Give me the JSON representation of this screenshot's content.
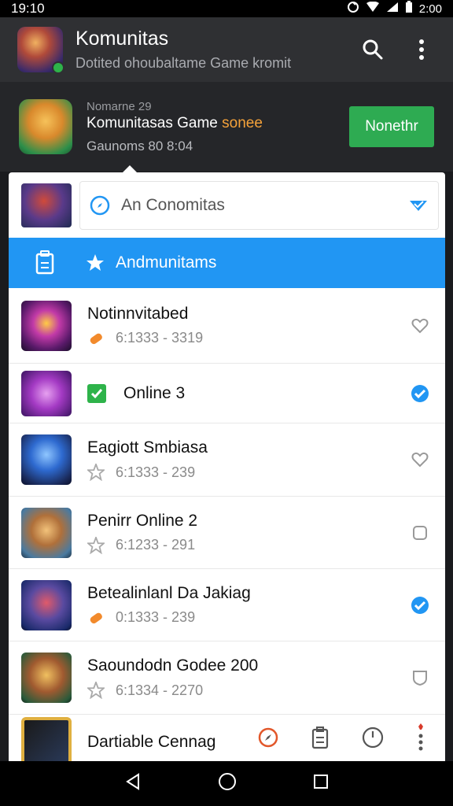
{
  "status_bar": {
    "time": "19:10",
    "clock_right": "2:00"
  },
  "app_bar": {
    "title": "Komunitas",
    "subtitle": "Dotited ohoubaltame Game kromit",
    "icons": [
      "search-icon",
      "more-vert-icon"
    ]
  },
  "banner": {
    "small_text": "Nomarne 29",
    "title": "Komunitasas Game",
    "title_accent": "sonee",
    "meta": "Gaunoms 80 8:04",
    "button_label": "Nonethr"
  },
  "search": {
    "value": "An Conomitas",
    "icon": "compass-icon"
  },
  "selected_item": {
    "label": "Andmunitams",
    "icon": "star-icon"
  },
  "list": [
    {
      "title": "Notinnvitabed",
      "meta": "6:1333 - 3319",
      "meta_icon": "gamepad-icon",
      "status": "heart",
      "checked": false
    },
    {
      "title": "Online 3",
      "meta": "",
      "meta_icon": "online-check-icon",
      "status": "check",
      "checked": true
    },
    {
      "title": "Eagiott Smbiasa",
      "meta": "6:1333 - 239",
      "meta_icon": "star-outline-icon",
      "status": "heart",
      "checked": false
    },
    {
      "title": "Penirr Online 2",
      "meta": "6:1233 - 291",
      "meta_icon": "star-outline-icon",
      "status": "box",
      "checked": false
    },
    {
      "title": "Betealinlanl Da Jakiag",
      "meta": "0:1333 - 239",
      "meta_icon": "gamepad-icon",
      "status": "check",
      "checked": true
    },
    {
      "title": "Saoundodn Godee 200",
      "meta": "6:1334 - 2270",
      "meta_icon": "star-outline-icon",
      "status": "shield",
      "checked": false
    },
    {
      "title": "Dartiable Cennag",
      "meta": "",
      "meta_icon": "gamepad-icon",
      "status": "",
      "checked": false
    }
  ],
  "colors": {
    "accent_blue": "#2196f3",
    "join_green": "#2eab52",
    "app_bar": "#2f3033",
    "orange": "#f5a23a"
  }
}
